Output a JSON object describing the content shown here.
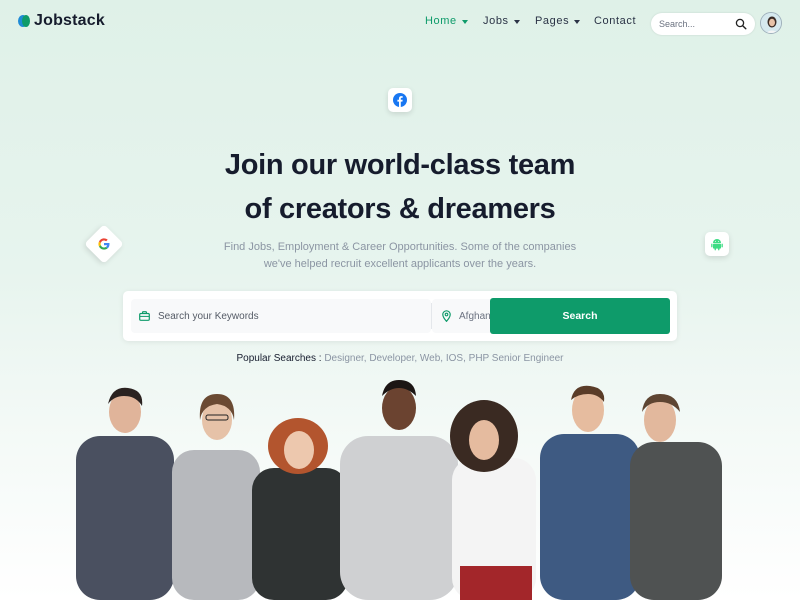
{
  "brand": {
    "name": "Jobstack"
  },
  "nav": {
    "items": [
      {
        "label": "Home",
        "active": true,
        "dropdown": true
      },
      {
        "label": "Jobs",
        "active": false,
        "dropdown": true
      },
      {
        "label": "Pages",
        "active": false,
        "dropdown": true
      },
      {
        "label": "Contact",
        "active": false,
        "dropdown": false
      }
    ],
    "search_placeholder": "Search..."
  },
  "hero": {
    "title_line1": "Join our world-class team",
    "title_line2": "of creators & dreamers",
    "subtitle_line1": "Find Jobs, Employment & Career Opportunities. Some of the companies",
    "subtitle_line2": "we've helped recruit excellent applicants over the years."
  },
  "search_form": {
    "keywords_placeholder": "Search your Keywords",
    "location_value": "Afghanistan",
    "button_label": "Search"
  },
  "popular": {
    "label": "Popular Searches :",
    "tags": "Designer, Developer, Web, IOS, PHP Senior Engineer"
  },
  "colors": {
    "accent": "#0e9b6a",
    "heading": "#161c2d",
    "muted": "#8b95a3",
    "facebook": "#1877f2",
    "android": "#3ddc84"
  },
  "icons": [
    "facebook-icon",
    "google-icon",
    "android-icon",
    "briefcase-icon",
    "map-pin-icon",
    "search-icon",
    "chevron-down-icon"
  ]
}
